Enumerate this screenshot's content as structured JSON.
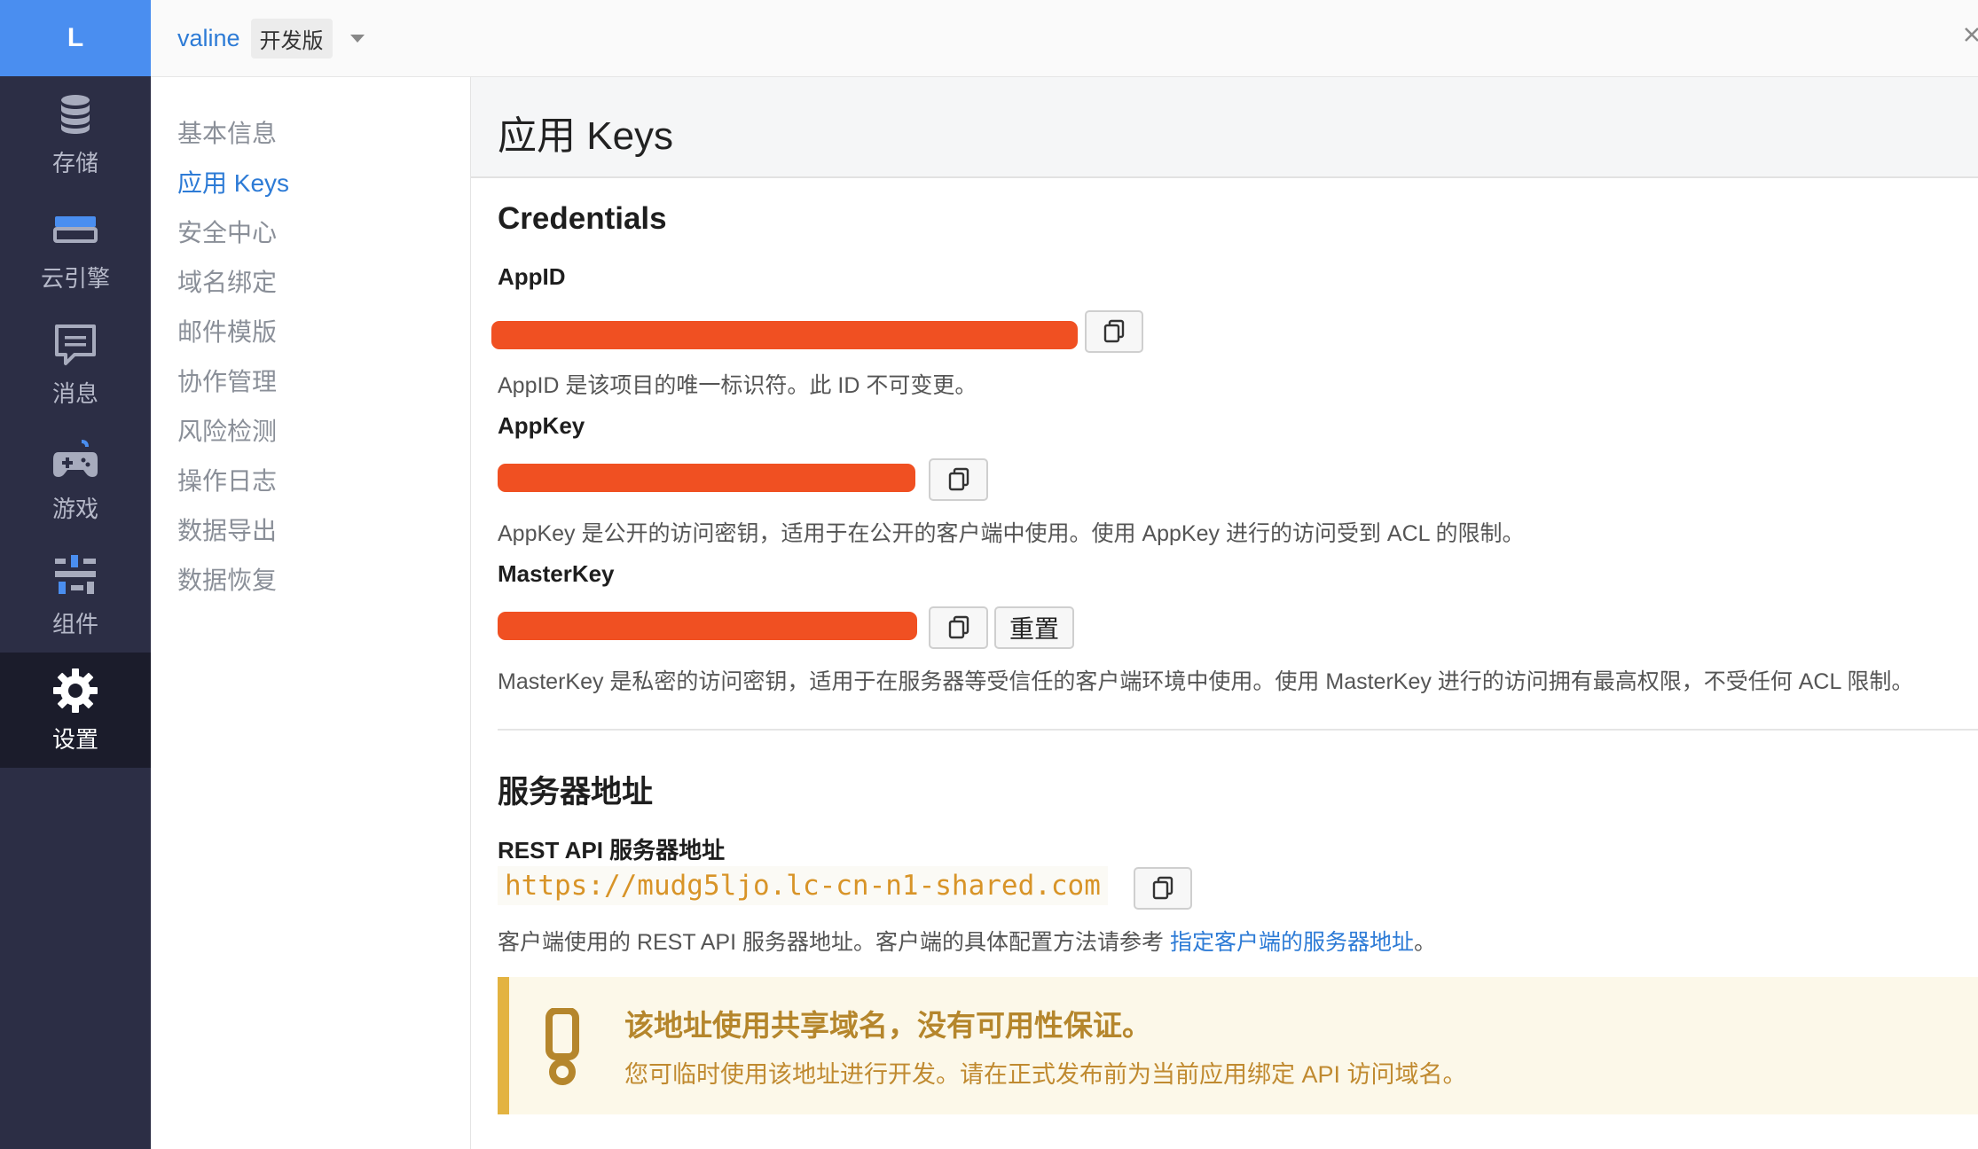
{
  "rail": {
    "logo": "L",
    "items": [
      {
        "label": "存储",
        "icon": "database-icon"
      },
      {
        "label": "云引擎",
        "icon": "server-icon"
      },
      {
        "label": "消息",
        "icon": "message-icon"
      },
      {
        "label": "游戏",
        "icon": "gamepad-icon"
      },
      {
        "label": "组件",
        "icon": "components-icon"
      },
      {
        "label": "设置",
        "icon": "gear-icon",
        "active": true
      }
    ]
  },
  "topbar": {
    "app_name": "valine",
    "env_badge": "开发版"
  },
  "subnav": {
    "items": [
      "基本信息",
      "应用 Keys",
      "安全中心",
      "域名绑定",
      "邮件模版",
      "协作管理",
      "风险检测",
      "操作日志",
      "数据导出",
      "数据恢复"
    ],
    "active": "应用 Keys"
  },
  "page": {
    "title": "应用 Keys"
  },
  "credentials": {
    "heading": "Credentials",
    "appid": {
      "label": "AppID",
      "desc": "AppID 是该项目的唯一标识符。此 ID 不可变更。"
    },
    "appkey": {
      "label": "AppKey",
      "desc": "AppKey 是公开的访问密钥，适用于在公开的客户端中使用。使用 AppKey 进行的访问受到 ACL 的限制。"
    },
    "masterkey": {
      "label": "MasterKey",
      "desc": "MasterKey 是私密的访问密钥，适用于在服务器等受信任的客户端环境中使用。使用 MasterKey 进行的访问拥有最高权限，不受任何 ACL 限制。",
      "reset_label": "重置"
    }
  },
  "server": {
    "heading": "服务器地址",
    "rest_label": "REST API 服务器地址",
    "rest_url": "https://mudg5ljo.lc-cn-n1-shared.com",
    "desc_prefix": "客户端使用的 REST API 服务器地址。客户端的具体配置方法请参考 ",
    "desc_link": "指定客户端的服务器地址",
    "desc_suffix": "。"
  },
  "alert": {
    "title": "该地址使用共享域名，没有可用性保证。",
    "body": "您可临时使用该地址进行开发。请在正式发布前为当前应用绑定 API 访问域名。",
    "icon": "exclamation-icon"
  },
  "colors": {
    "rail_bg": "#2c2e45",
    "logo_bg": "#4a8ef0",
    "accent": "#2d7bd6",
    "redaction": "#f05022",
    "alert_border": "#e3b341"
  }
}
